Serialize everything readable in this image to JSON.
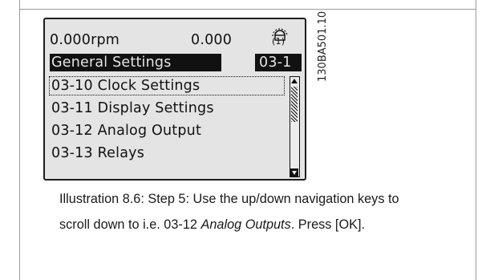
{
  "lcd": {
    "speed": "0.000rpm",
    "value": "0.000",
    "menu_indicator": "(1)",
    "header_title": "General Settings",
    "header_code": "03-1",
    "items": [
      {
        "label": "03-10 Clock Settings"
      },
      {
        "label": "03-11 Display Settings"
      },
      {
        "label": "03-12 Analog Output"
      },
      {
        "label": "03-13 Relays"
      }
    ]
  },
  "figure_code": "130BA501.10",
  "caption": {
    "line1": "Illustration 8.6: Step 5: Use the up/down navigation keys to",
    "line2_prefix": "scroll down to i.e. 03-12 ",
    "line2_emph": "Analog Outputs",
    "line2_suffix": ". Press [OK]."
  },
  "colors": {
    "lcd_bg": "#e4e4e4",
    "lcd_ink": "#111111"
  }
}
